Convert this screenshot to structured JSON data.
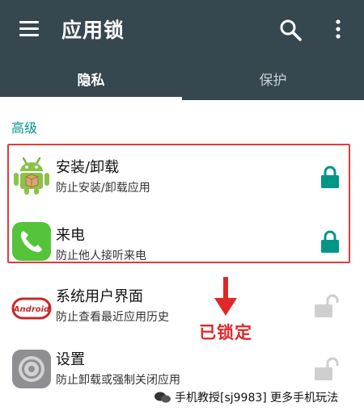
{
  "app_bar": {
    "title": "应用锁",
    "background_color": "#37474f",
    "icons": [
      "menu-icon",
      "search-icon",
      "more-vert-icon"
    ]
  },
  "tabs": [
    {
      "label": "隐私",
      "selected": true
    },
    {
      "label": "保护",
      "selected": false
    }
  ],
  "section": {
    "title": "高级",
    "color": "#009688"
  },
  "apps": [
    {
      "name": "安装/卸载",
      "desc": "防止安装/卸载应用",
      "icon": "android-icon",
      "locked": true
    },
    {
      "name": "来电",
      "desc": "防止他人接听来电",
      "icon": "phone-icon",
      "locked": true
    },
    {
      "name": "系统用户界面",
      "desc": "防止查看最近应用历史",
      "icon": "android-kitkat-icon",
      "locked": false
    },
    {
      "name": "设置",
      "desc": "防止卸载或强制关闭应用",
      "icon": "settings-gear-icon",
      "locked": false
    }
  ],
  "annotation": {
    "label": "已锁定",
    "color": "#e02828"
  },
  "watermark": {
    "text": "手机教授[sj9983] 更多手机玩法"
  },
  "colors": {
    "lock_locked": "#009688",
    "lock_unlocked": "#cfcfcf",
    "highlight_border": "#e23b3b"
  }
}
